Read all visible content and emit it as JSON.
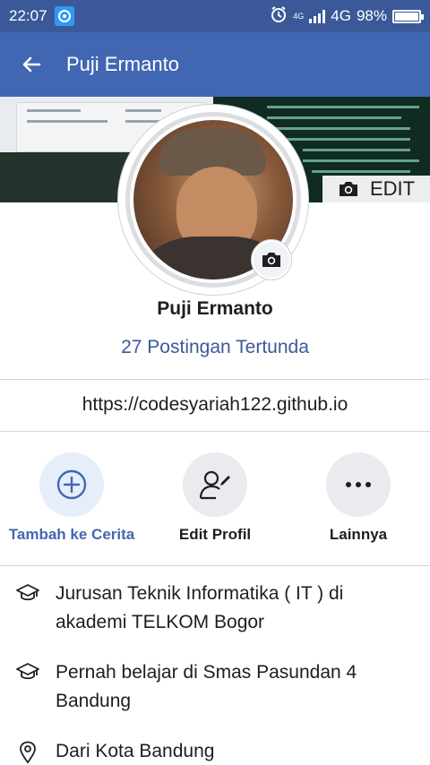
{
  "status_bar": {
    "time": "22:07",
    "network_small": "4G",
    "network": "4G",
    "battery_level": 0.98,
    "battery": "98%",
    "icons": [
      "app-notification-icon",
      "alarm-icon",
      "signal-icon",
      "battery-icon"
    ]
  },
  "app_bar": {
    "title": "Puji Ermanto",
    "back_icon": "back-arrow-icon"
  },
  "cover": {
    "edit_label": "EDIT",
    "edit_icon": "camera-icon"
  },
  "profile": {
    "name": "Puji Ermanto",
    "pending_posts": "27 Postingan Tertunda",
    "website": "https://codesyariah122.github.io"
  },
  "actions": [
    {
      "label": "Tambah ke Cerita",
      "icon": "plus-circle-icon",
      "accent": "#4267b2"
    },
    {
      "label": "Edit Profil",
      "icon": "edit-profile-icon"
    },
    {
      "label": "Lainnya",
      "icon": "more-icon"
    }
  ],
  "info": [
    {
      "icon": "graduation-cap-icon",
      "text": "Jurusan Teknik Informatika ( IT ) di akademi TELKOM Bogor"
    },
    {
      "icon": "graduation-cap-icon",
      "text": "Pernah belajar di Smas Pasundan 4 Bandung"
    },
    {
      "icon": "location-pin-icon",
      "text": "Dari Kota Bandung"
    }
  ],
  "colors": {
    "status_bar": "#3b5998",
    "app_bar": "#4267b2",
    "link": "#3b5998"
  }
}
